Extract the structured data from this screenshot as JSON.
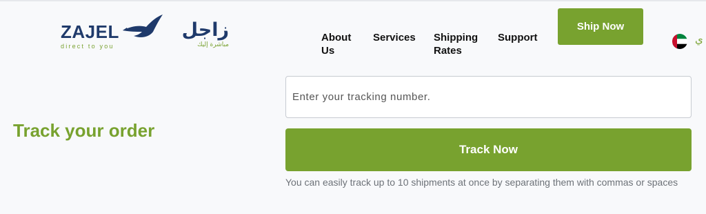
{
  "brand": {
    "name_latin": "ZAJEL",
    "tagline_latin": "direct to you",
    "name_arabic": "زاجل",
    "tagline_arabic": "مباشرة إليك",
    "logo_icon": "bird-icon",
    "colors": {
      "navy": "#1f3a6b",
      "green": "#78a22f"
    }
  },
  "nav": {
    "items": [
      {
        "label": "About Us"
      },
      {
        "label": "Services"
      },
      {
        "label": "Shipping Rates"
      },
      {
        "label": "Support"
      }
    ],
    "ship_now_label": "Ship Now",
    "country_flag_icon": "uae-flag-icon",
    "language_label": "ي"
  },
  "main": {
    "title": "Track your order",
    "tracking_input": {
      "value": "",
      "placeholder": "Enter your tracking number."
    },
    "track_button_label": "Track Now",
    "hint": "You can easily track up to 10 shipments at once by separating them with commas or spaces"
  }
}
